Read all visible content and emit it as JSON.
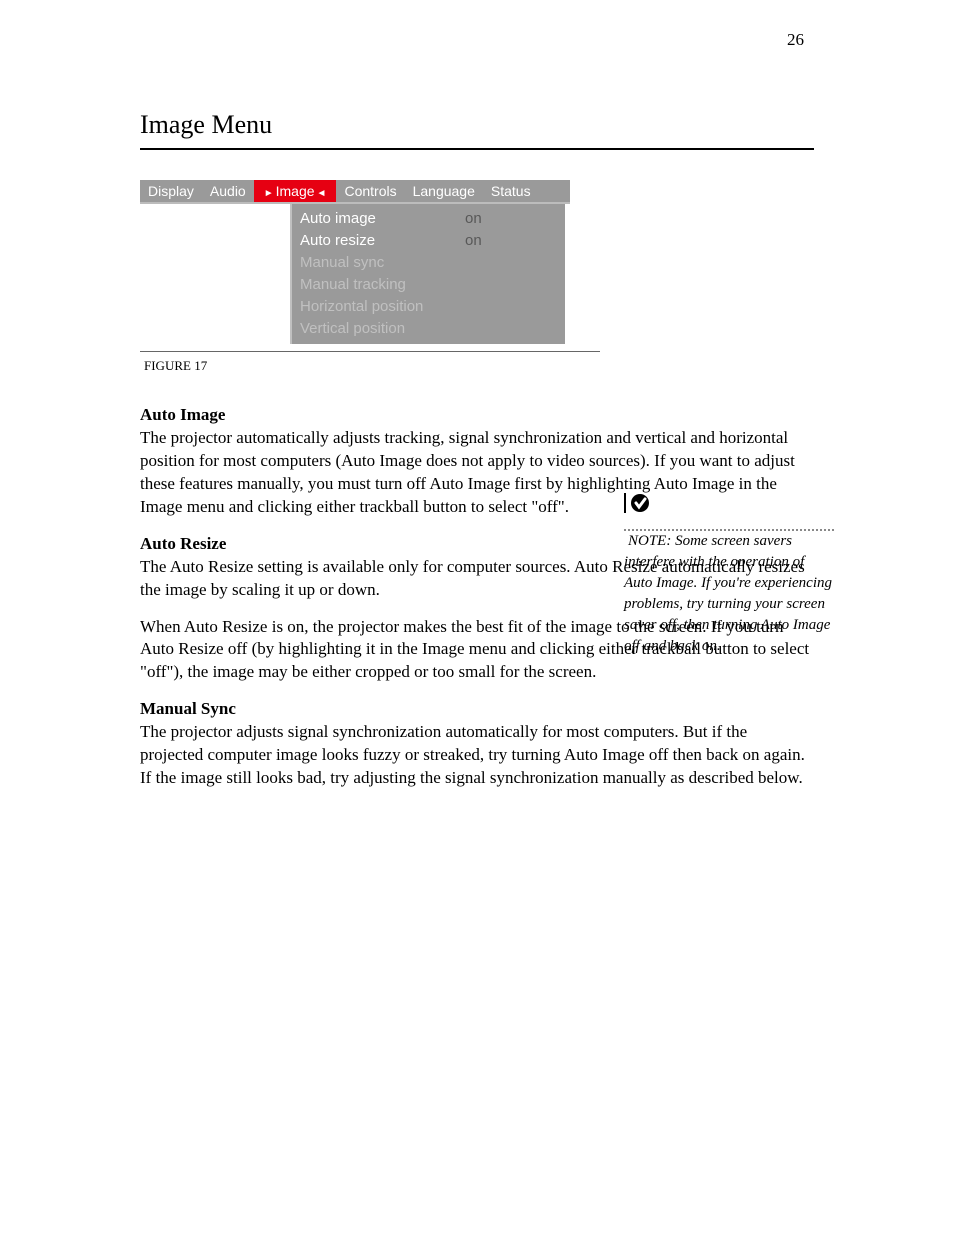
{
  "page_number": "26",
  "section_title": "Image Menu",
  "osd": {
    "tabs": [
      "Display",
      "Audio",
      "Image",
      "Controls",
      "Language",
      "Status"
    ],
    "active_tab_index": 2,
    "rows": [
      {
        "label": "Auto image",
        "value": "on",
        "dim": false
      },
      {
        "label": "Auto resize",
        "value": "on",
        "dim": false
      },
      {
        "label": "Manual sync",
        "value": "",
        "dim": true
      },
      {
        "label": "Manual tracking",
        "value": "",
        "dim": true
      },
      {
        "label": "Horizontal position",
        "value": "",
        "dim": true
      },
      {
        "label": "Vertical position",
        "value": "",
        "dim": true
      }
    ]
  },
  "figure_caption": "FIGURE 17",
  "items": [
    {
      "title": "Auto Image",
      "body": "The projector automatically adjusts tracking, signal synchronization and vertical and horizontal position for most computers (Auto Image does not apply to video sources). If you want to adjust these features manually, you must turn off Auto Image first by highlighting Auto Image in the Image menu and clicking either trackball button to select \"off\"."
    },
    {
      "title": "Auto Resize",
      "body": "The Auto Resize setting is available only for computer sources. Auto Resize automatically resizes the image by scaling it up or down."
    },
    {
      "title": "",
      "body": "When Auto Resize is on, the projector makes the best fit of the image to the screen. If you turn Auto Resize off (by highlighting it in the Image menu and clicking either trackball button to select \"off\"), the image may be either cropped or too small for the screen."
    },
    {
      "title": "Manual Sync",
      "body": "The projector adjusts signal synchronization automatically for most computers. But if the projected computer image looks fuzzy or streaked, try turning Auto Image off then back on again. If the image still looks bad, try adjusting the signal synchronization manually as described below."
    }
  ],
  "sidebar": {
    "note_label": "NOTE:",
    "note_text": " Some screen savers interfere with the operation of Auto Image. If you're experiencing problems, try turning your screen saver off, then turning Auto Image off and back on."
  }
}
